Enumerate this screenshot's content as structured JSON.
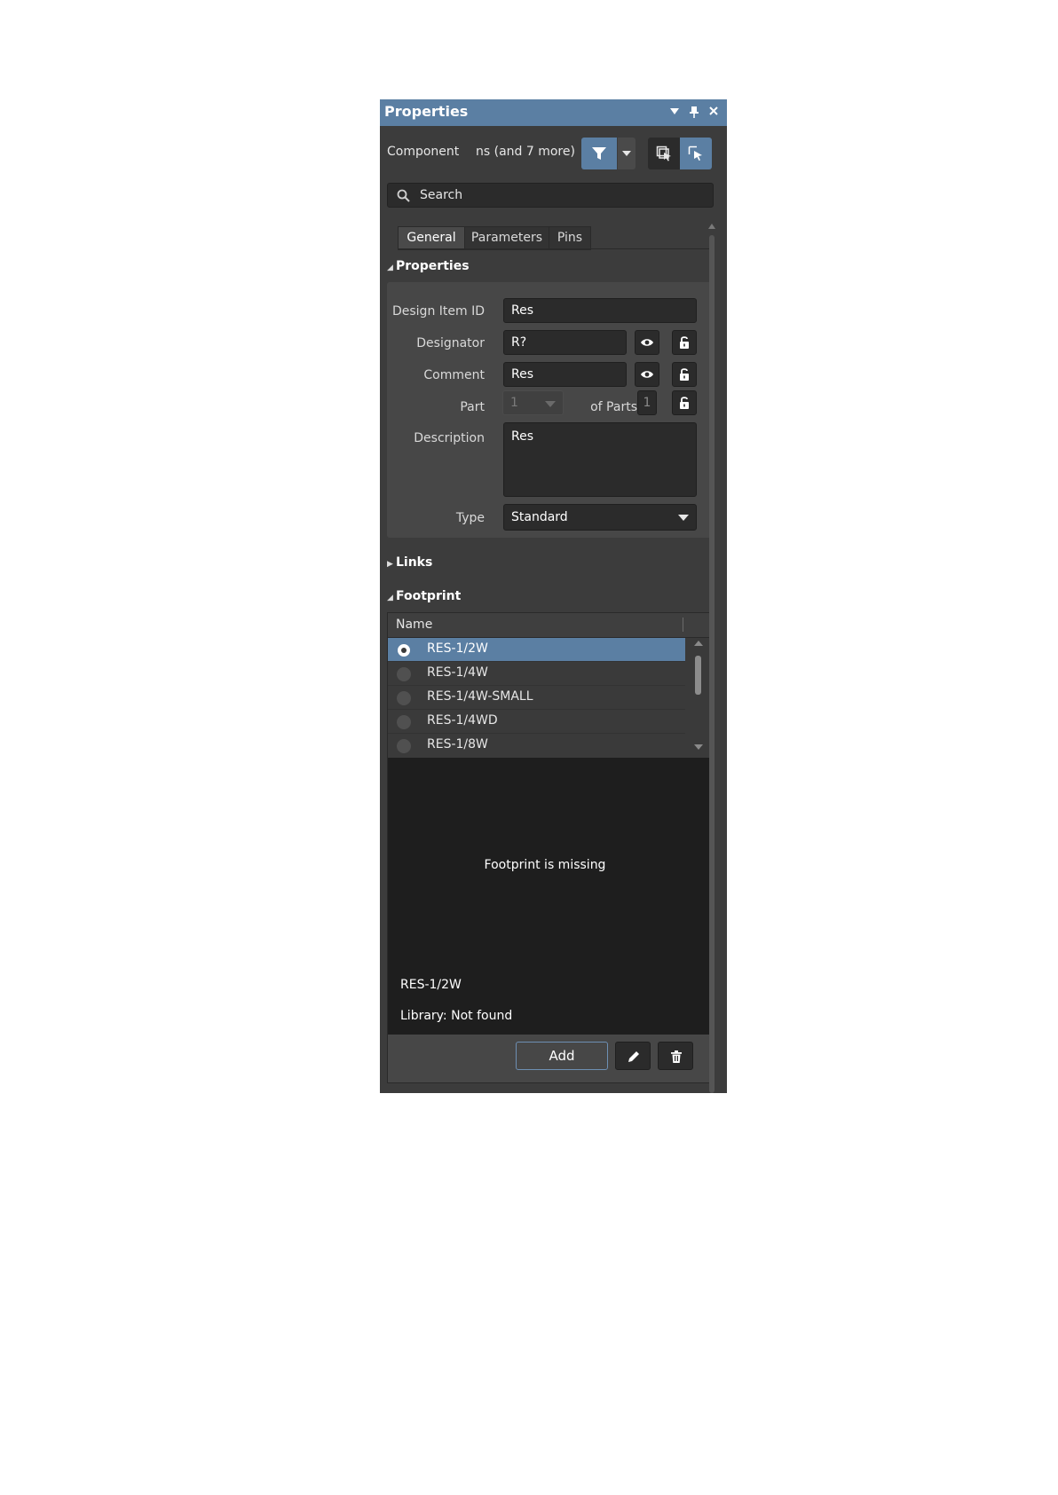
{
  "panel": {
    "title": "Properties",
    "component_label": "Component",
    "selection_summary": "ns (and 7 more)",
    "search_placeholder": "Search"
  },
  "tabs": [
    {
      "label": "General",
      "active": true
    },
    {
      "label": "Parameters",
      "active": false
    },
    {
      "label": "Pins",
      "active": false
    }
  ],
  "sections": {
    "properties": "Properties",
    "links": "Links",
    "footprint": "Footprint"
  },
  "properties": {
    "design_item_id_label": "Design Item ID",
    "design_item_id_value": "Res",
    "designator_label": "Designator",
    "designator_value": "R?",
    "comment_label": "Comment",
    "comment_value": "Res",
    "part_label": "Part",
    "part_value": "1",
    "of_parts_label": "of Parts",
    "of_parts_value": "1",
    "description_label": "Description",
    "description_value": "Res",
    "type_label": "Type",
    "type_value": "Standard"
  },
  "footprint": {
    "column_name": "Name",
    "items": [
      {
        "name": "RES-1/2W",
        "selected": true
      },
      {
        "name": "RES-1/4W",
        "selected": false
      },
      {
        "name": "RES-1/4W-SMALL",
        "selected": false
      },
      {
        "name": "RES-1/4WD",
        "selected": false
      },
      {
        "name": "RES-1/8W",
        "selected": false
      }
    ],
    "preview_message": "Footprint is missing",
    "selected_name": "RES-1/2W",
    "library_label": "Library:",
    "library_value": "Not found",
    "add_label": "Add"
  },
  "colors": {
    "accent": "#5b7fa3",
    "panel_bg": "#3c3c3c",
    "field_bg": "#2b2b2b",
    "preview_bg": "#1e1e1e"
  },
  "icons": {
    "menu": "chevron-down-icon",
    "pin": "pin-icon",
    "close": "close-icon",
    "filter": "filter-icon",
    "select_a": "select-box-icon",
    "select_b": "select-cursor-icon",
    "search": "search-icon",
    "visibility": "eye-icon",
    "lock": "unlock-icon",
    "edit": "pencil-icon",
    "delete": "trash-icon"
  }
}
